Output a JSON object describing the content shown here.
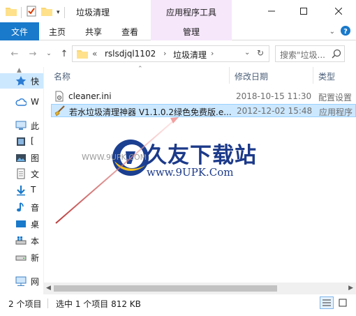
{
  "window": {
    "title": "垃圾清理",
    "context_tab_group": "应用程序工具"
  },
  "ribbon": {
    "file": "文件",
    "tabs": [
      "主页",
      "共享",
      "查看"
    ],
    "manage": "管理"
  },
  "address": {
    "overflow": "«",
    "crumbs": [
      "rslsdjql1102",
      "垃圾清理"
    ],
    "search_placeholder": "搜索\"垃圾..."
  },
  "nav": [
    {
      "label": "快",
      "icon": "star-icon"
    },
    {
      "label": "W",
      "icon": "cloud-icon"
    },
    {
      "label": "此",
      "icon": "computer-icon"
    },
    {
      "label": "[",
      "icon": "video-icon"
    },
    {
      "label": "图",
      "icon": "picture-icon"
    },
    {
      "label": "文",
      "icon": "document-icon"
    },
    {
      "label": "T",
      "icon": "download-icon"
    },
    {
      "label": "音",
      "icon": "music-icon"
    },
    {
      "label": "桌",
      "icon": "desktop-icon"
    },
    {
      "label": "本",
      "icon": "windows-drive-icon"
    },
    {
      "label": "新",
      "icon": "drive-icon"
    },
    {
      "label": "网",
      "icon": "network-icon"
    }
  ],
  "columns": {
    "name": "名称",
    "date": "修改日期",
    "type": "类型"
  },
  "files": [
    {
      "name": "cleaner.ini",
      "date": "2018-10-15 11:30",
      "type": "配置设置",
      "icon": "ini-file-icon",
      "selected": false
    },
    {
      "name": "若水垃圾清理神器 V1.1.0.2绿色免费版.e...",
      "date": "2012-12-02 15:48",
      "type": "应用程序",
      "icon": "broom-app-icon",
      "selected": true
    }
  ],
  "watermark": {
    "title": "久友下载站",
    "url": "www.9UPK.Com",
    "small": "WWW.9UPK.COM"
  },
  "status": {
    "count": "2 个项目",
    "selection": "选中 1 个项目  812 KB"
  },
  "colors": {
    "accent": "#1979ca",
    "selection": "#cce8ff",
    "context_tab": "#f6e7fb"
  }
}
